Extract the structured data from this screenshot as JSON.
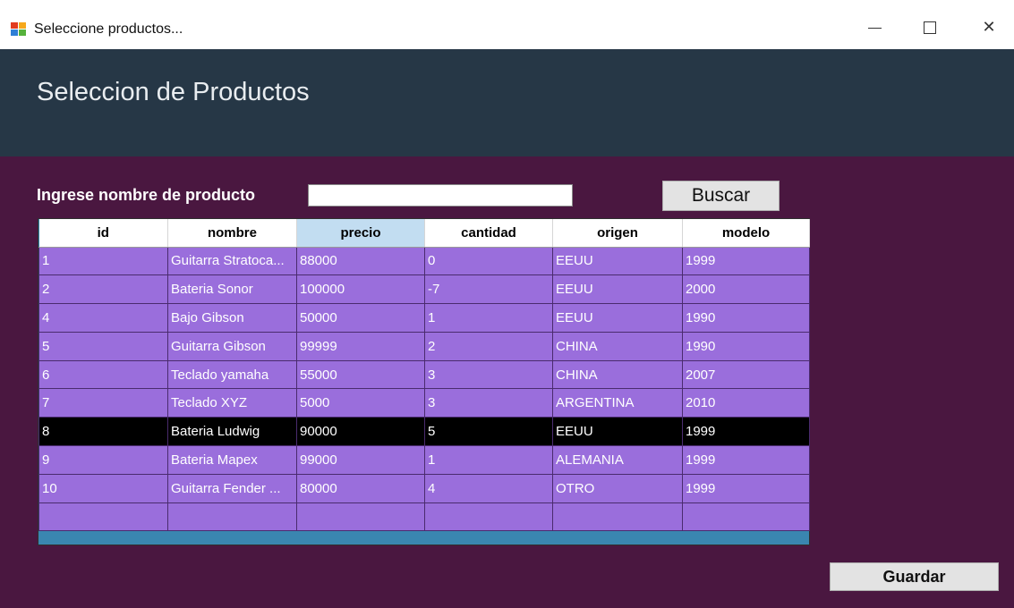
{
  "window": {
    "title": "Seleccione productos...",
    "minimize": "—",
    "close": "✕"
  },
  "header": {
    "title": "Seleccion de Productos"
  },
  "search": {
    "label": "Ingrese nombre de producto",
    "value": "",
    "button_label": "Buscar"
  },
  "grid": {
    "columns": [
      "id",
      "nombre",
      "precio",
      "cantidad",
      "origen",
      "modelo"
    ],
    "sorted_column": "precio",
    "selected_row": 6,
    "rows": [
      [
        "1",
        "Guitarra Stratoca...",
        "88000",
        "0",
        "EEUU",
        "1999"
      ],
      [
        "2",
        "Bateria Sonor",
        "100000",
        "-7",
        "EEUU",
        "2000"
      ],
      [
        "4",
        "Bajo Gibson",
        "50000",
        "1",
        "EEUU",
        "1990"
      ],
      [
        "5",
        "Guitarra Gibson",
        "99999",
        "2",
        "CHINA",
        "1990"
      ],
      [
        "6",
        "Teclado yamaha",
        "55000",
        "3",
        "CHINA",
        "2007"
      ],
      [
        "7",
        "Teclado XYZ",
        "5000",
        "3",
        "ARGENTINA",
        "2010"
      ],
      [
        "8",
        "Bateria  Ludwig",
        "90000",
        "5",
        "EEUU",
        "1999"
      ],
      [
        "9",
        "Bateria Mapex",
        "99000",
        "1",
        "ALEMANIA",
        "1999"
      ],
      [
        "10",
        "Guitarra Fender ...",
        "80000",
        "4",
        "OTRO",
        "1999"
      ],
      [
        "",
        "",
        "",
        "",
        "",
        ""
      ]
    ]
  },
  "footer": {
    "save_label": "Guardar"
  },
  "colors": {
    "header_bg": "#263746",
    "content_bg": "#4a1740",
    "row_bg": "#9a6edc",
    "selected_row_bg": "#000000"
  }
}
